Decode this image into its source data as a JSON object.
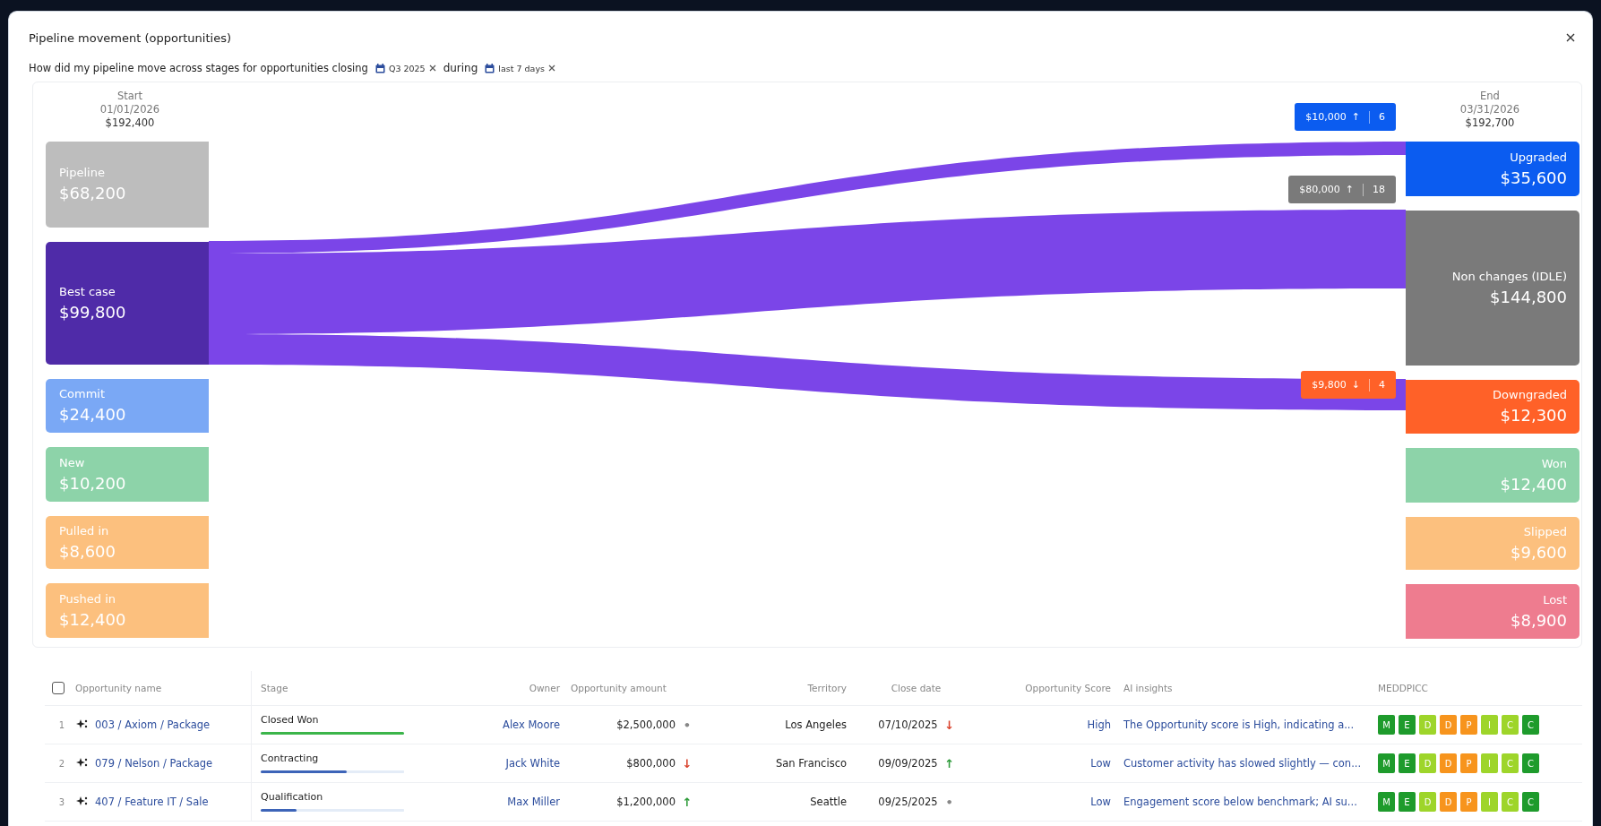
{
  "window": {
    "title": "Pipeline movement (opportunities)"
  },
  "query": {
    "prefix": "How did my pipeline move across stages for opportunities closing",
    "period": {
      "label": "Q3 2025"
    },
    "connector": "during",
    "window": {
      "label": "last 7 days"
    }
  },
  "chart": {
    "start": {
      "label": "Start",
      "date": "01/01/2026",
      "total": "$192,400"
    },
    "end": {
      "label": "End",
      "date": "03/31/2026",
      "total": "$192,700"
    },
    "sources": [
      {
        "label": "Pipeline",
        "value": "$68,200",
        "color": "#bdbdbd"
      },
      {
        "label": "Best case",
        "value": "$99,800",
        "color": "#4f2ba8"
      },
      {
        "label": "Commit",
        "value": "$24,400",
        "color": "#7aa8f5"
      },
      {
        "label": "New",
        "value": "$10,200",
        "color": "#8dd3a9"
      },
      {
        "label": "Pulled in",
        "value": "$8,600",
        "color": "#fcc07e"
      },
      {
        "label": "Pushed in",
        "value": "$12,400",
        "color": "#fcc07e"
      }
    ],
    "targets": [
      {
        "label": "Upgraded",
        "value": "$35,600",
        "color": "#0b5cf0"
      },
      {
        "label": "Non changes (IDLE)",
        "value": "$144,800",
        "color": "#7a7a7a"
      },
      {
        "label": "Downgraded",
        "value": "$12,300",
        "color": "#ff6128"
      },
      {
        "label": "Won",
        "value": "$12,400",
        "color": "#8dd3a9"
      },
      {
        "label": "Slipped",
        "value": "$9,600",
        "color": "#fcc07e"
      },
      {
        "label": "Lost",
        "value": "$8,900",
        "color": "#ee7c8f"
      }
    ],
    "flows": [
      {
        "amount": "$10,000",
        "arrow": "↑",
        "count": "6",
        "color": "#0b5cf0"
      },
      {
        "amount": "$80,000",
        "arrow": "↑",
        "count": "18",
        "color": "#7a7a7a"
      },
      {
        "amount": "$9,800",
        "arrow": "↓",
        "count": "4",
        "color": "#ff6128"
      }
    ]
  },
  "table": {
    "select_all": {
      "checked": false
    },
    "columns": [
      "Opportunity name",
      "Stage",
      "Owner",
      "Opportunity amount",
      "Territory",
      "Close date",
      "Opportunity Score",
      "AI insights",
      "MEDDPICC"
    ],
    "rows": [
      {
        "index": "1",
        "name": "003 / Axiom / Package",
        "stage": "Closed Won",
        "stage_progress": {
          "level": 1.0,
          "color": "#3bb54a"
        },
        "owner": "Alex Moore",
        "amount": "$2,500,000",
        "amount_trend": {
          "symbol": "•",
          "color": "#888888"
        },
        "territory": "Los Angeles",
        "close_date": "07/10/2025",
        "date_trend": {
          "symbol": "↓",
          "color": "#d9412b"
        },
        "score": "High",
        "insight": "The Opportunity score is High, indicating a...",
        "meddpicc": [
          {
            "letter": "M",
            "color": "#1e9b2c"
          },
          {
            "letter": "E",
            "color": "#1e9b2c"
          },
          {
            "letter": "D",
            "color": "#9ed52a"
          },
          {
            "letter": "D",
            "color": "#f7941d"
          },
          {
            "letter": "P",
            "color": "#f7941d"
          },
          {
            "letter": "I",
            "color": "#9ed52a"
          },
          {
            "letter": "C",
            "color": "#9ed52a"
          },
          {
            "letter": "C",
            "color": "#1e9b2c"
          }
        ]
      },
      {
        "index": "2",
        "name": "079 / Nelson / Package",
        "stage": "Contracting",
        "stage_progress": {
          "level": 0.6,
          "color": "#3d64b8"
        },
        "owner": "Jack White",
        "amount": "$800,000",
        "amount_trend": {
          "symbol": "↓",
          "color": "#d9412b"
        },
        "territory": "San Francisco",
        "close_date": "09/09/2025",
        "date_trend": {
          "symbol": "↑",
          "color": "#2e9b3a"
        },
        "score": "Low",
        "insight": "Customer activity has slowed slightly — con...",
        "meddpicc": [
          {
            "letter": "M",
            "color": "#1e9b2c"
          },
          {
            "letter": "E",
            "color": "#1e9b2c"
          },
          {
            "letter": "D",
            "color": "#9ed52a"
          },
          {
            "letter": "D",
            "color": "#f7941d"
          },
          {
            "letter": "P",
            "color": "#f7941d"
          },
          {
            "letter": "I",
            "color": "#9ed52a"
          },
          {
            "letter": "C",
            "color": "#9ed52a"
          },
          {
            "letter": "C",
            "color": "#1e9b2c"
          }
        ]
      },
      {
        "index": "3",
        "name": "407 / Feature IT / Sale",
        "stage": "Qualification",
        "stage_progress": {
          "level": 0.25,
          "color": "#3d64b8"
        },
        "owner": "Max Miller",
        "amount": "$1,200,000",
        "amount_trend": {
          "symbol": "↑",
          "color": "#2e9b3a"
        },
        "territory": "Seattle",
        "close_date": "09/25/2025",
        "date_trend": {
          "symbol": "•",
          "color": "#888888"
        },
        "score": "Low",
        "insight": "Engagement score below benchmark; AI su...",
        "meddpicc": [
          {
            "letter": "M",
            "color": "#1e9b2c"
          },
          {
            "letter": "E",
            "color": "#1e9b2c"
          },
          {
            "letter": "D",
            "color": "#9ed52a"
          },
          {
            "letter": "D",
            "color": "#f7941d"
          },
          {
            "letter": "P",
            "color": "#f7941d"
          },
          {
            "letter": "I",
            "color": "#9ed52a"
          },
          {
            "letter": "C",
            "color": "#9ed52a"
          },
          {
            "letter": "C",
            "color": "#1e9b2c"
          }
        ]
      }
    ]
  }
}
